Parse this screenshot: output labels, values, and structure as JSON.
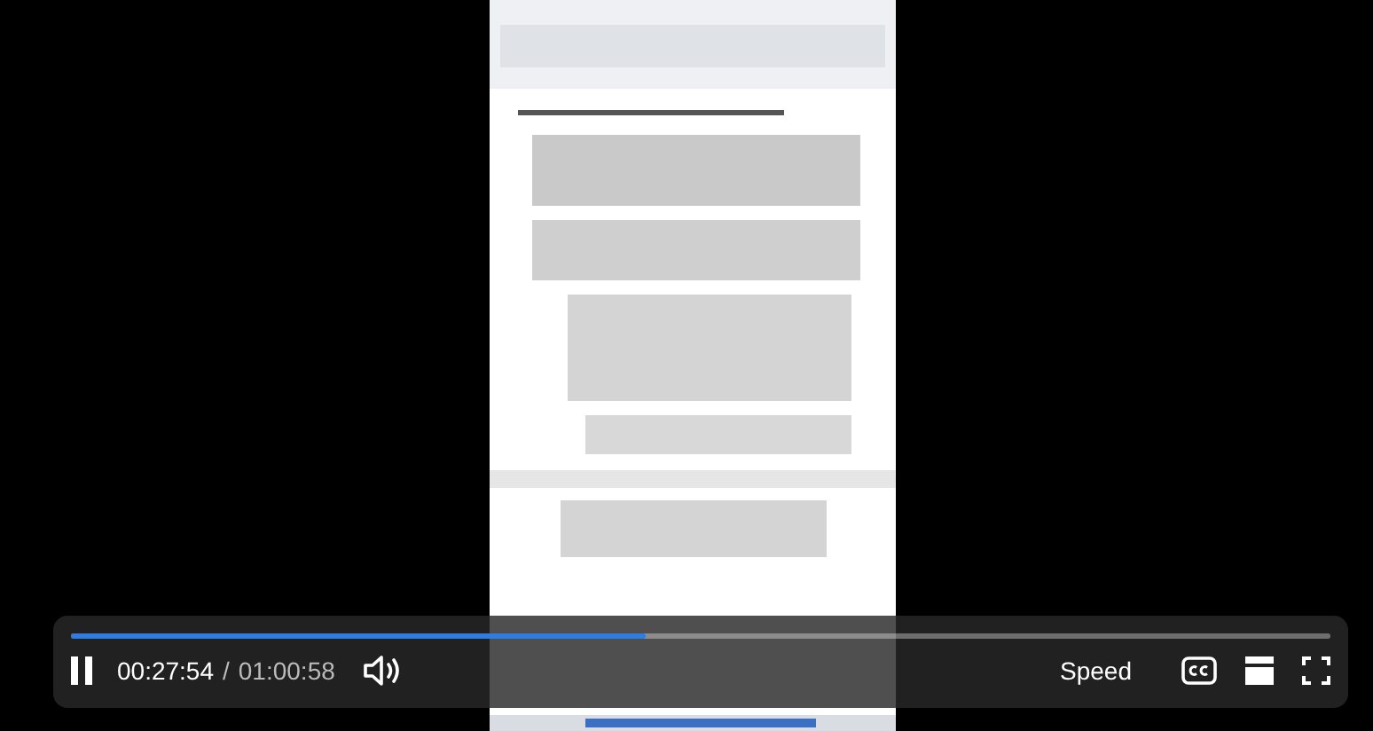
{
  "player": {
    "playing": true,
    "progress": {
      "level": 0.457
    },
    "elapsed": "00:27:54",
    "separator": "/",
    "duration": "01:00:58",
    "speed_label": "Speed"
  }
}
